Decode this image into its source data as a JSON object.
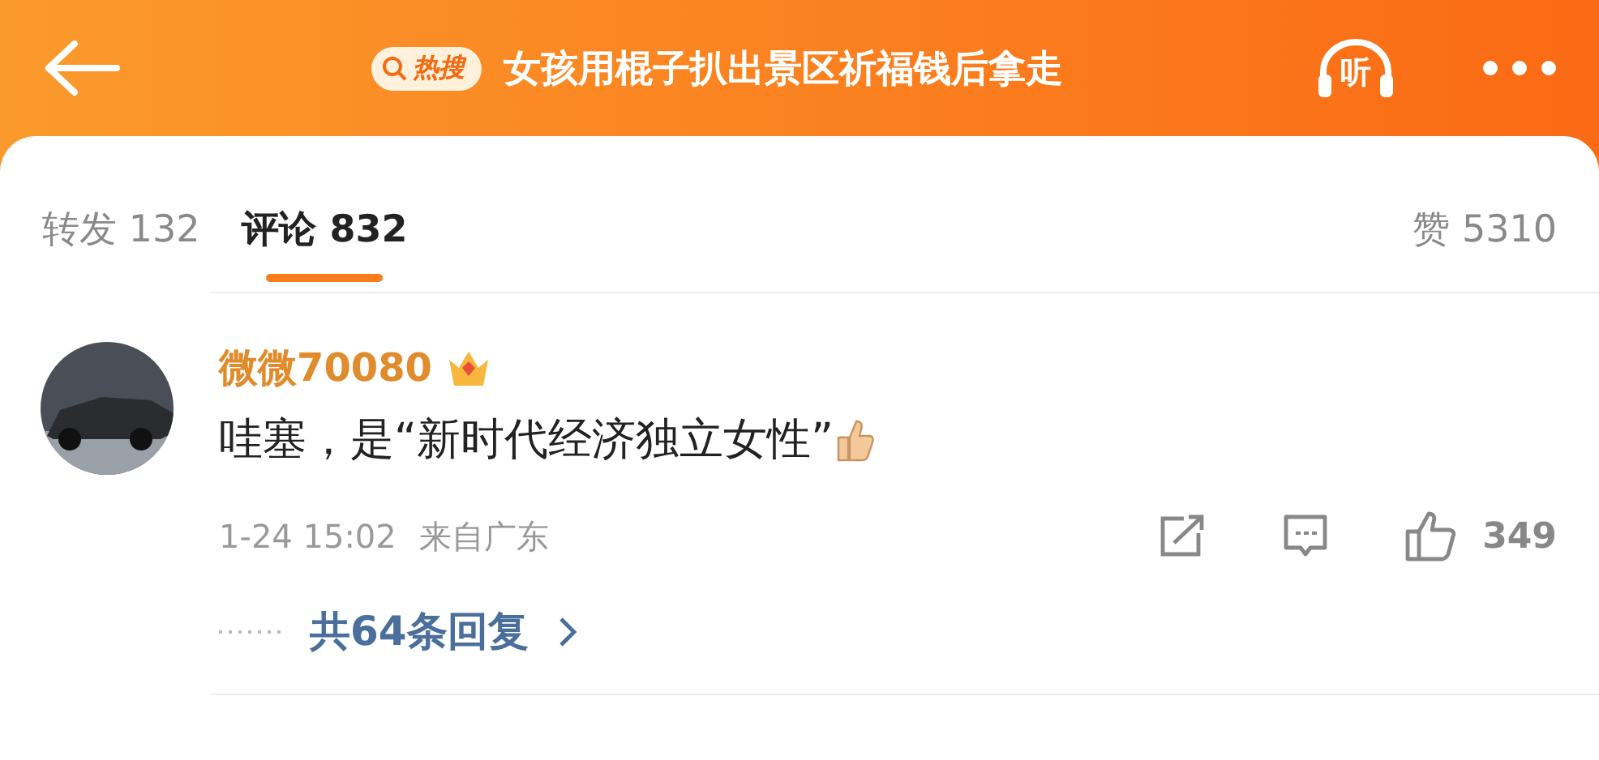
{
  "header": {
    "badge": "热搜",
    "title": "女孩用棍子扒出景区祈福钱后拿走",
    "listen_label": "听"
  },
  "tabs": [
    {
      "label": "转发",
      "count": "132",
      "selected": false
    },
    {
      "label": "评论",
      "count": "832",
      "selected": true
    },
    {
      "label": "赞",
      "count": "5310",
      "selected": false
    }
  ],
  "comment": {
    "user": "微微70080",
    "text": "哇塞，是“新时代经济独立女性”",
    "time": "1-24 15:02",
    "location": "来自广东",
    "likes": "349",
    "replies": "共64条回复"
  }
}
